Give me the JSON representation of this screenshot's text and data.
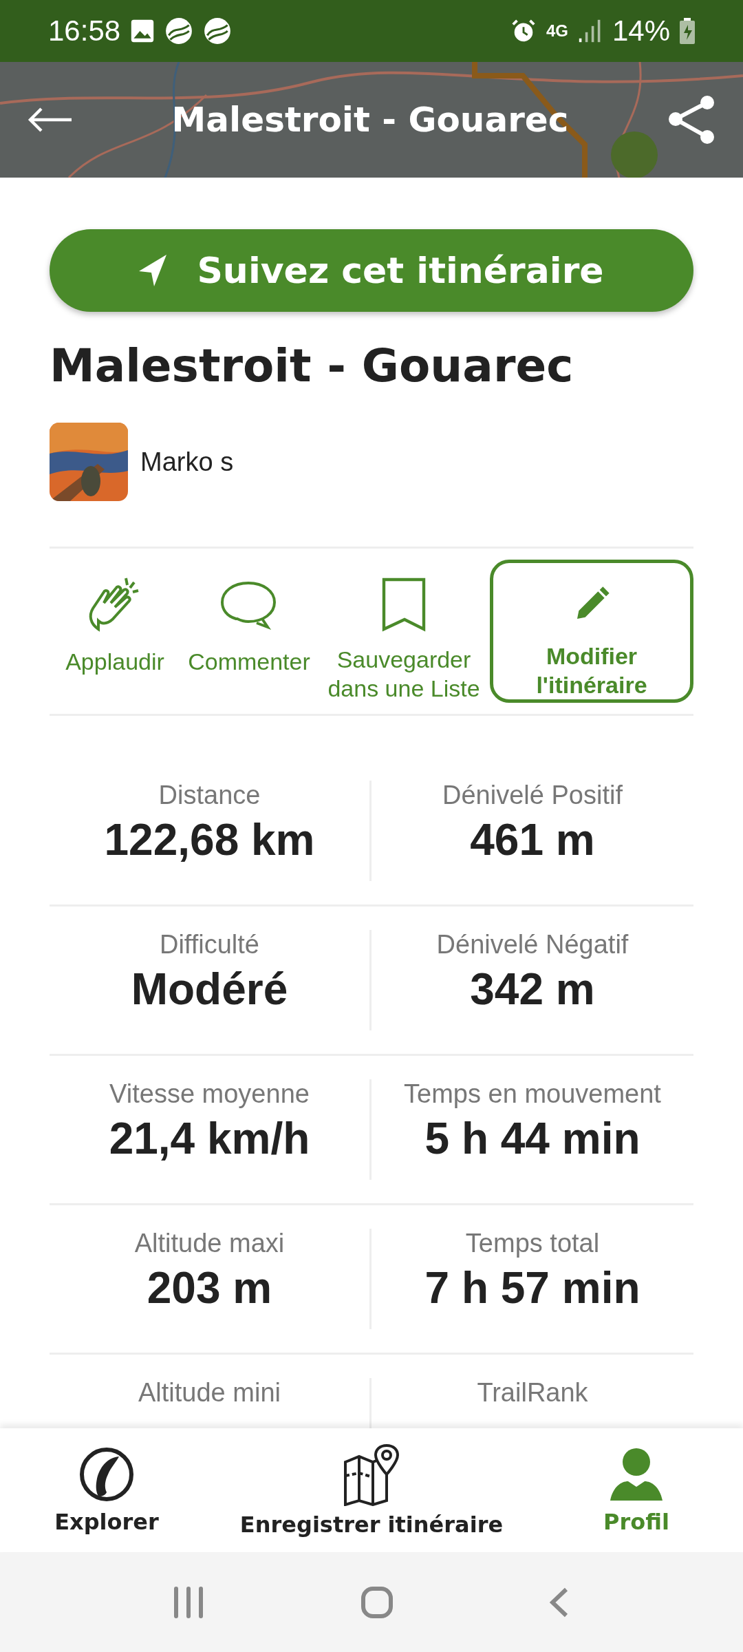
{
  "status_bar": {
    "time": "16:58",
    "network": "4G",
    "battery": "14%"
  },
  "header": {
    "title": "Malestroit - Gouarec"
  },
  "follow_button": {
    "label": "Suivez cet itinéraire"
  },
  "title": "Malestroit - Gouarec",
  "author": {
    "name": "Marko s"
  },
  "actions": [
    {
      "kind": "clap",
      "label": "Applaudir",
      "selected": false
    },
    {
      "kind": "comment",
      "label": "Commenter",
      "selected": false
    },
    {
      "kind": "bookmark",
      "label": "Sauvegarder dans une Liste",
      "selected": false
    },
    {
      "kind": "edit",
      "label": "Modifier l'itinéraire",
      "selected": true
    }
  ],
  "stats": [
    [
      {
        "label": "Distance",
        "value": "122,68 km"
      },
      {
        "label": "Dénivelé Positif",
        "value": "461 m"
      }
    ],
    [
      {
        "label": "Difficulté",
        "value": "Modéré"
      },
      {
        "label": "Dénivelé Négatif",
        "value": "342 m"
      }
    ],
    [
      {
        "label": "Vitesse moyenne",
        "value": "21,4 km/h"
      },
      {
        "label": "Temps en mouvement",
        "value": "5 h 44 min"
      }
    ],
    [
      {
        "label": "Altitude maxi",
        "value": "203 m"
      },
      {
        "label": "Temps total",
        "value": "7 h 57 min"
      }
    ],
    [
      {
        "label": "Altitude mini"
      },
      {
        "label": "TrailRank"
      }
    ]
  ],
  "bottom_nav": [
    {
      "kind": "explore",
      "label": "Explorer",
      "selected": false
    },
    {
      "kind": "record",
      "label": "Enregistrer itinéraire",
      "selected": false
    },
    {
      "kind": "profile",
      "label": "Profil",
      "selected": true
    }
  ]
}
